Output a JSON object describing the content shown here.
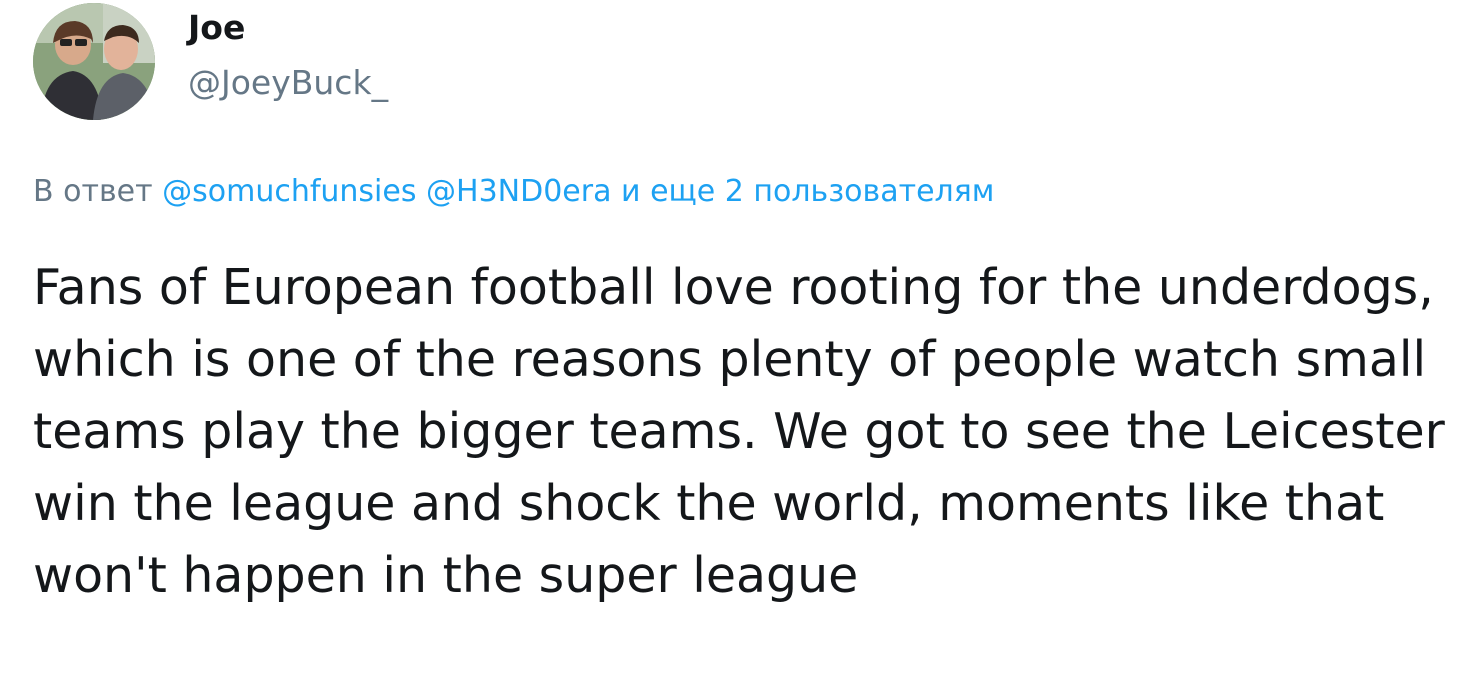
{
  "user": {
    "display_name": "Joe",
    "handle": "@JoeyBuck_"
  },
  "reply": {
    "prefix": "В ответ",
    "mention_1": "@somuchfunsies",
    "mention_2": "@H3ND0era",
    "others": "и еще 2 пользователям"
  },
  "tweet": {
    "text": "Fans of European football love rooting for the underdogs, which is one of the reasons plenty of people watch small teams play the bigger teams. We got to see the Leicester win the league and shock the world, moments like that won't happen in the super league"
  },
  "colors": {
    "link": "#1da1f2",
    "secondary": "#657786",
    "text": "#14171a"
  }
}
